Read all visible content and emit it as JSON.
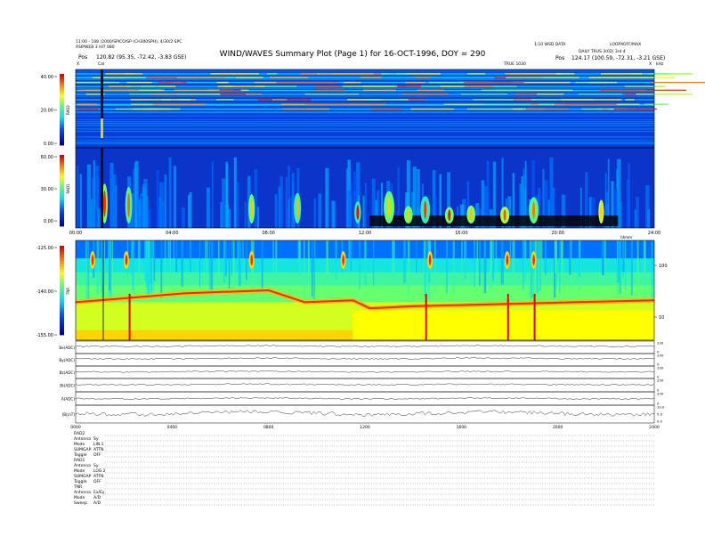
{
  "header": {
    "title": "WIND/WAVES Summary Plot (Page 1) for 16-OCT-1996, DOY = 290",
    "left_line1": "11:00 - 108 (2000/SPICO/SP (CH300SPH), 4/30/2 SPC",
    "left_line2": "ASIPWEB 3 HIT 080",
    "left_pos_label": "Pos",
    "left_pos_value": "120.82 (95.35, -72.42, -3.83 GSE)",
    "right_line1": "1:10 WSD DATA",
    "right_line2": "DAILY TRUS 3(02) 3rd 4",
    "right_line_top_right": "LOOPXOFF/MAX",
    "right_pos_label": "Pos",
    "right_pos_value": "124.17 (100.59, -72.31, -3.21 GSE)",
    "marker_left": "X",
    "marker_mid": "Cal",
    "marker_right": "X",
    "rad2_corner": "TRUE 1030",
    "page_corner": "kHz"
  },
  "chart_data": [
    {
      "type": "heatmap",
      "panel": "RAD2",
      "ylabel": "RAD2",
      "yticks": [
        "40.00",
        "20.00",
        "0.00"
      ],
      "ylim": [
        0,
        40
      ],
      "x_range_hours": [
        0,
        24
      ],
      "background_color": "#0c3bd4",
      "bright_bands_frac": [
        0.05,
        0.1,
        0.16,
        0.21,
        0.26,
        0.31,
        0.38,
        0.44,
        0.5
      ],
      "colorbar": [
        "#ff0000",
        "#ff8800",
        "#ffff00",
        "#66ff66",
        "#00ddff",
        "#0066ff",
        "#0000aa"
      ]
    },
    {
      "type": "heatmap",
      "panel": "RAD1",
      "ylabel": "RAD1",
      "yticks": [
        "60.00",
        "30.00",
        "0.00"
      ],
      "ylim": [
        0,
        60
      ],
      "x_range_hours": [
        0,
        24
      ],
      "xticks": [
        "00:00",
        "04:00",
        "08:00",
        "12:00",
        "16:00",
        "20:00",
        "24:00"
      ],
      "x_unit": "hhmm",
      "emission_events_hours": [
        1.2,
        2.2,
        7.3,
        9.2,
        11.7,
        13.0,
        13.8,
        14.5,
        15.5,
        16.4,
        17.8,
        19.0,
        21.8
      ],
      "dark_interval_hours": [
        12.2,
        22.5
      ]
    },
    {
      "type": "heatmap",
      "panel": "TNR",
      "ylabel": "TNR",
      "yticks": [
        "-125.00",
        "-140.00",
        "-155.00"
      ],
      "ylim": [
        -155,
        -125
      ],
      "right_ticks": [
        "100",
        "10"
      ],
      "x_range_hours": [
        0,
        24
      ],
      "plasma_line_frac": [
        [
          0,
          0.62
        ],
        [
          4.5,
          0.53
        ],
        [
          8,
          0.5
        ],
        [
          9.5,
          0.62
        ],
        [
          11.5,
          0.6
        ],
        [
          12.2,
          0.68
        ],
        [
          14,
          0.66
        ],
        [
          24,
          0.6
        ]
      ],
      "bursts_hours": [
        0.7,
        2.1,
        7.3,
        11.1,
        14.7,
        17.9,
        19.0
      ]
    },
    {
      "type": "line",
      "panel": "magnetic",
      "series": [
        {
          "name": "Bx(ADC)",
          "right_ticks": [
            "230",
            "0"
          ],
          "level": 0.4
        },
        {
          "name": "By(ADC)",
          "right_ticks": [
            "230",
            "0"
          ],
          "level": 0.4
        },
        {
          "name": "Bz(ADC)",
          "right_ticks": [
            "230",
            "0"
          ],
          "level": 0.45
        },
        {
          "name": "Bt(ADC)",
          "right_ticks": [
            "230",
            "0"
          ],
          "level": 0.45
        },
        {
          "name": "A(ADC)",
          "right_ticks": [
            "230",
            "0"
          ],
          "level": 0.5
        },
        {
          "name": "|B|(nT)",
          "right_ticks": [
            "10.0",
            "5.0",
            "0.0"
          ],
          "level": 0.45
        }
      ],
      "xticks": [
        "0000",
        "0400",
        "0800",
        "1200",
        "1600",
        "2000",
        "2400"
      ]
    }
  ],
  "footer": {
    "rows": [
      {
        "label": "RAD2",
        "value": ""
      },
      {
        "label": "Antenna",
        "value": "Sy"
      },
      {
        "label": "Mode",
        "value": "LIN 1"
      },
      {
        "label": "SUMGAP",
        "value": "ATTN"
      },
      {
        "label": "Toggle",
        "value": "OFF"
      },
      {
        "label": "RAD1",
        "value": ""
      },
      {
        "label": "Antenna",
        "value": "Sy"
      },
      {
        "label": "Mode",
        "value": "LOG 2"
      },
      {
        "label": "SUMGAP",
        "value": "ATTN"
      },
      {
        "label": "Toggle",
        "value": "OFF"
      },
      {
        "label": "TNR",
        "value": ""
      },
      {
        "label": "Antenna",
        "value": "Ex/Ey"
      },
      {
        "label": "Mode",
        "value": "A/D"
      },
      {
        "label": "Sweep",
        "value": "A/D"
      }
    ]
  }
}
